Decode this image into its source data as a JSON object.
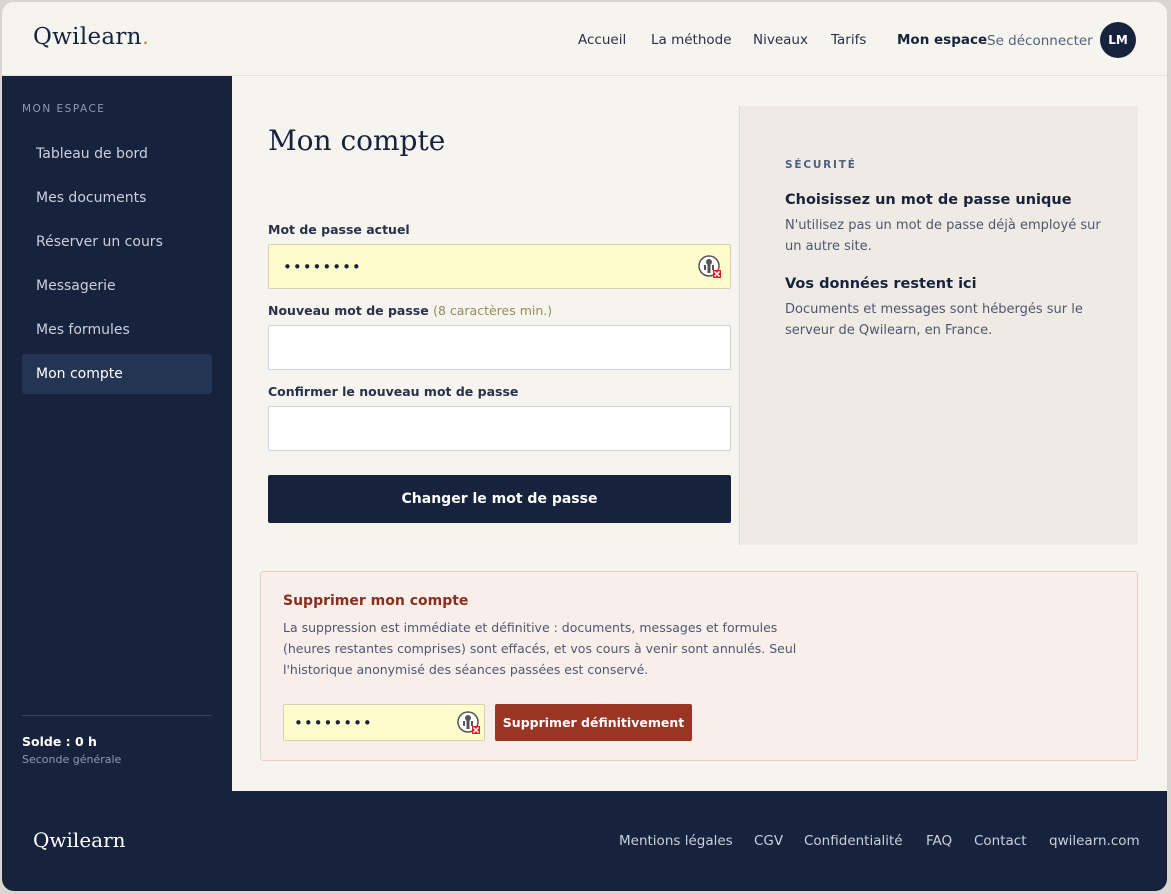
{
  "brand": {
    "logo_main": "Qwi",
    "logo_rest": "learn",
    "logo_dot": "."
  },
  "nav": {
    "items": [
      "Accueil",
      "La méthode",
      "Niveaux",
      "Tarifs"
    ],
    "account": "Mon espace",
    "logout": "Se déconnecter",
    "avatar_initials": "LM"
  },
  "sidebar": {
    "heading": "MON ESPACE",
    "items": [
      "Tableau de bord",
      "Mes documents",
      "Réserver un cours",
      "Messagerie",
      "Mes formules",
      "Mon compte"
    ],
    "active_index": 5,
    "solde": "Solde : 0 h",
    "niveau": "Seconde générale"
  },
  "main": {
    "title": "Mon compte",
    "current_password_label": "Mot de passe actuel",
    "current_password_value": "••••••••",
    "new_password_label": "Nouveau mot de passe",
    "new_password_hint": "(8 caractères min.)",
    "new_password_value": "",
    "confirm_password_label": "Confirmer le nouveau mot de passe",
    "confirm_password_value": "",
    "submit_label": "Changer le mot de passe"
  },
  "security": {
    "kicker": "SÉCURITÉ",
    "tip1_title": "Choisissez un mot de passe unique",
    "tip1_text": "N'utilisez pas un mot de passe déjà employé sur un autre site.",
    "tip2_title": "Vos données restent ici",
    "tip2_text": "Documents et messages sont hébergés sur le serveur de Qwilearn, en France."
  },
  "danger": {
    "title": "Supprimer mon compte",
    "text": "La suppression est immédiate et définitive : documents, messages et formules (heures restantes comprises) sont effacés, et vos cours à venir sont annulés. Seul l'historique anonymisé des séances passées est conservé.",
    "password_value": "••••••••",
    "button_label": "Supprimer définitivement"
  },
  "footer": {
    "logo_main": "Qwi",
    "logo_rest": "learn",
    "links": [
      "Mentions légales",
      "CGV",
      "Confidentialité",
      "FAQ",
      "Contact",
      "qwilearn.com"
    ]
  },
  "colors": {
    "navy": "#17233d",
    "danger": "#9a3524",
    "autofill": "#fefbcd",
    "panel": "#efebe4"
  },
  "icons": {
    "password_manager": "password-manager-key-icon"
  }
}
